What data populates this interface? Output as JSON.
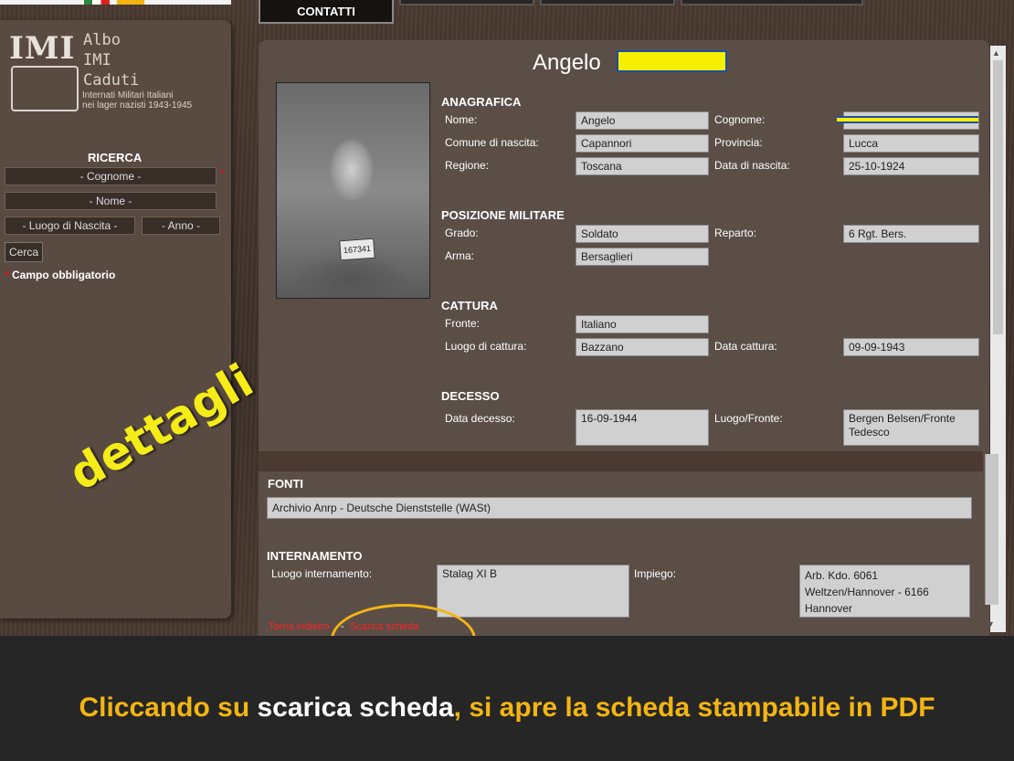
{
  "nav": {
    "active_tab": "CONTATTI"
  },
  "logo": {
    "mark": "IMI",
    "lines": [
      "Albo",
      "IMI",
      "Caduti"
    ],
    "subtitle_1": "Internati Militari Italiani",
    "subtitle_2": "nei lager nazisti 1943-1945"
  },
  "search": {
    "title": "RICERCA",
    "cognome": "- Cognome -",
    "nome": "- Nome -",
    "luogo_nascita": "- Luogo di Nascita -",
    "anno": "- Anno -",
    "button": "Cerca",
    "required_note": "Campo obbligatorio",
    "star": "*"
  },
  "overlay_label": "dettagli",
  "record": {
    "title": "Angelo",
    "photo_tag": "167341",
    "anagrafica": {
      "heading": "ANAGRAFICA",
      "nome_label": "Nome:",
      "nome": "Angelo",
      "cognome_label": "Cognome:",
      "comune_label": "Comune di nascita:",
      "comune": "Capannori",
      "provincia_label": "Provincia:",
      "provincia": "Lucca",
      "regione_label": "Regione:",
      "regione": "Toscana",
      "data_nascita_label": "Data di nascita:",
      "data_nascita": "25-10-1924"
    },
    "militare": {
      "heading": "POSIZIONE MILITARE",
      "grado_label": "Grado:",
      "grado": "Soldato",
      "reparto_label": "Reparto:",
      "reparto": "6 Rgt. Bers.",
      "arma_label": "Arma:",
      "arma": "Bersaglieri"
    },
    "cattura": {
      "heading": "CATTURA",
      "fronte_label": "Fronte:",
      "fronte": "Italiano",
      "luogo_label": "Luogo di cattura:",
      "luogo": "Bazzano",
      "data_label": "Data cattura:",
      "data": "09-09-1943"
    },
    "decesso": {
      "heading": "DECESSO",
      "data_label": "Data decesso:",
      "data": "16-09-1944",
      "luogo_label": "Luogo/Fronte:",
      "luogo": "Bergen Belsen/Fronte Tedesco"
    },
    "fonti": {
      "heading": "FONTI",
      "value": "Archivio Anrp - Deutsche Dienststelle (WASt)"
    },
    "internamento": {
      "heading": "INTERNAMENTO",
      "luogo_label": "Luogo internamento:",
      "luogo": "Stalag XI B",
      "impiego_label": "Impiego:",
      "impiego": "Arb. Kdo. 6061 Weltzen/Hannover - 6166 Hannover"
    },
    "links": {
      "back": "Torna indietro",
      "sep": "-",
      "download": "Scarica scheda"
    }
  },
  "caption": {
    "part1": "Cliccando su ",
    "part2": "scarica scheda",
    "part3": ", si apre la scheda stampabile in PDF"
  },
  "colors": {
    "caption_accent": "#f3b513",
    "redaction_yellow": "#f7ef00",
    "link_red": "#ff2222"
  }
}
